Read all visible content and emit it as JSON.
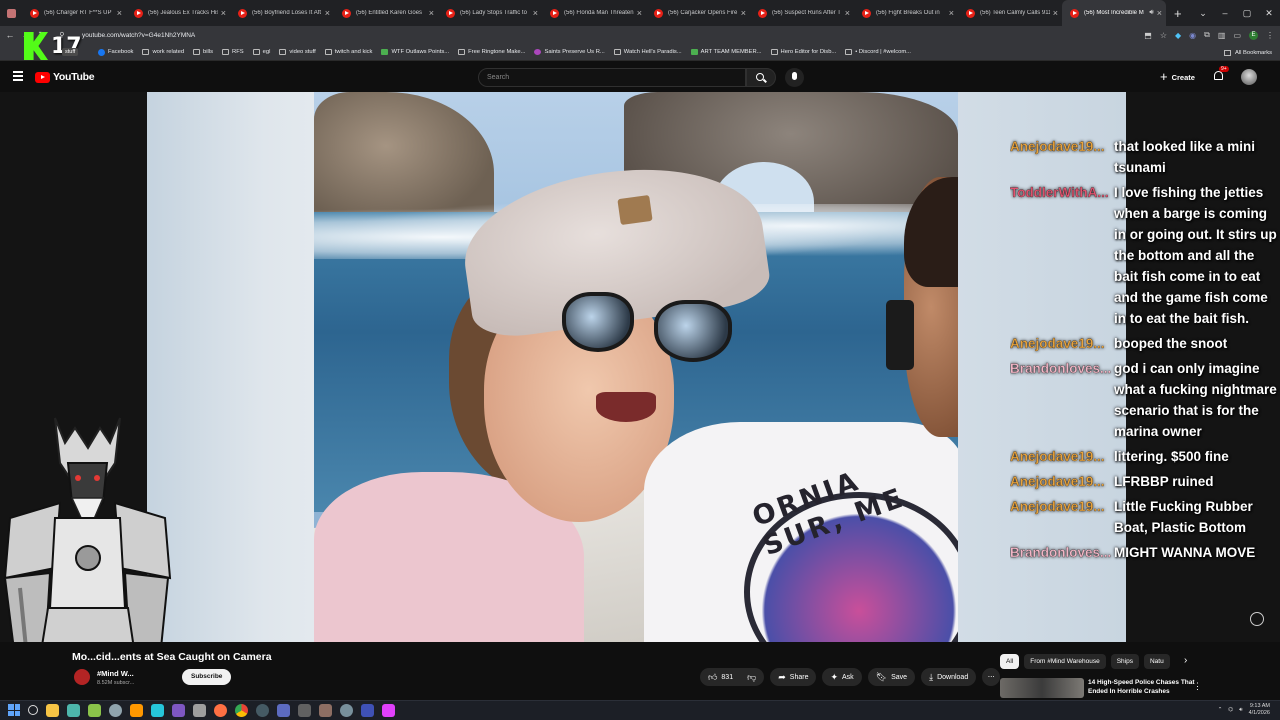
{
  "browser": {
    "tabs": [
      {
        "title": "(56) Charger RT F**S UP"
      },
      {
        "title": "(56) Jealous Ex Tracks His"
      },
      {
        "title": "(56) Boyfriend Loses It Aft"
      },
      {
        "title": "(56) Entitled Karen Goes"
      },
      {
        "title": "(56) Lady Stops Traffic to"
      },
      {
        "title": "(56) Florida Man Threaten"
      },
      {
        "title": "(56) Carjacker Opens Fire"
      },
      {
        "title": "(56) Suspect Runs After T"
      },
      {
        "title": "(56) Fight Breaks Out in"
      },
      {
        "title": "(56) Teen Calmly Calls 911"
      },
      {
        "title": "(56) Most Incredible M",
        "active": true
      }
    ],
    "url": "youtube.com/watch?v=G4e1Nh2YMNA",
    "profile_initial": "E",
    "bookmarks": [
      "Facebook",
      "work related",
      "bills",
      "RFS",
      "egl",
      "video stuff",
      "twitch and kick",
      "WTF Outlaws Points...",
      "Free Ringtone Make...",
      "Saints Preserve Us R...",
      "Watch Hell's Paradis...",
      "ART TEAM MEMBER...",
      "Hero Editor for Disb...",
      "• Discord | #welcom..."
    ],
    "all_bookmarks": "All Bookmarks",
    "stuff_chip": "stuff"
  },
  "overlay": {
    "follower_count": "17"
  },
  "youtube": {
    "logo_text": "YouTube",
    "search_placeholder": "Search",
    "create_label": "Create",
    "notification_count": "9+"
  },
  "chat": [
    {
      "user": "Anejodave19...",
      "color": "#e8a33d",
      "text": "that looked like a mini tsunami"
    },
    {
      "user": "ToddlerWithA...",
      "color": "#e25570",
      "text": "I love fishing the jetties when a barge is coming in or going out. It stirs up the bottom and all the bait fish come in to eat and the game fish come in to eat the bait fish."
    },
    {
      "user": "Anejodave19...",
      "color": "#e8a33d",
      "text": "booped the snoot"
    },
    {
      "user": "Brandonloves...",
      "color": "#f2b6c6",
      "text": "god i can only imagine what a fucking nightmare scenario that is for the marina owner"
    },
    {
      "user": "Anejodave19...",
      "color": "#e8a33d",
      "text": "littering. $500 fine"
    },
    {
      "user": "Anejodave19...",
      "color": "#e8a33d",
      "text": "LFRBBP ruined"
    },
    {
      "user": "Anejodave19...",
      "color": "#e8a33d",
      "text": "Little Fucking Rubber Boat, Plastic Bottom"
    },
    {
      "user": "Brandonloves...",
      "color": "#f2b6c6",
      "text": "MIGHT WANNA MOVE"
    }
  ],
  "video": {
    "shirt_text": "ORNIA SUR, ME",
    "title": "Mo...cid...ents at Sea Caught on Camera",
    "channel_name": "#Mind W...",
    "channel_subs": "8.52M subscr...",
    "subscribe_label": "Subscribe",
    "like_count": "831",
    "share_label": "Share",
    "ask_label": "Ask",
    "save_label": "Save",
    "download_label": "Download"
  },
  "recommendations": {
    "chips": [
      "All",
      "From #Mind Warehouse",
      "Ships",
      "Natu"
    ],
    "items": [
      {
        "title": "14 High-Speed Police Chases That Ended In Horrible Crashes"
      }
    ]
  },
  "taskbar": {
    "time": "9:13 AM",
    "date": "4/1/2026"
  }
}
